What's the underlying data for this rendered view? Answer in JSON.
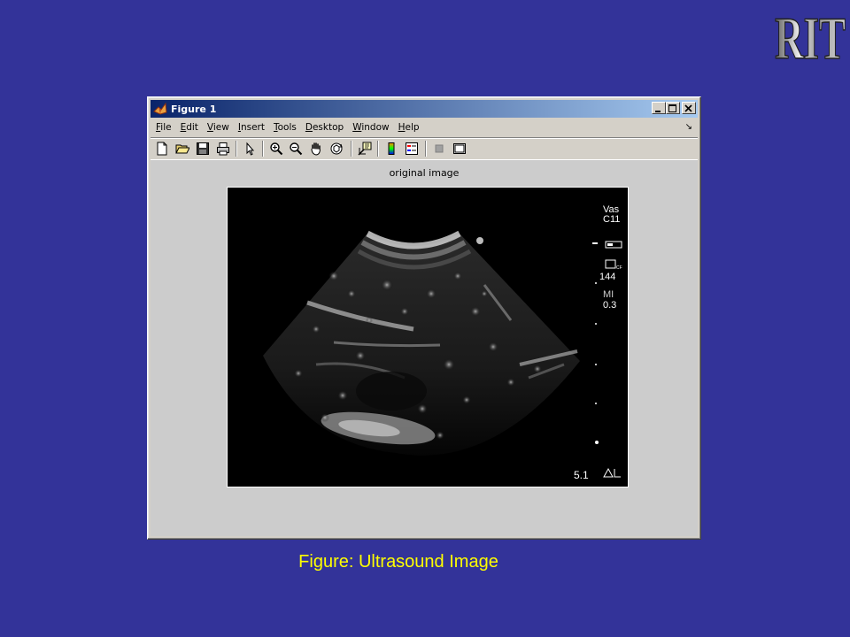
{
  "logo": {
    "text": "RIT"
  },
  "window": {
    "title": "Figure 1",
    "menu": [
      {
        "label": "File",
        "mnemonic": "F",
        "rest": "ile"
      },
      {
        "label": "Edit",
        "mnemonic": "E",
        "rest": "dit"
      },
      {
        "label": "View",
        "mnemonic": "V",
        "rest": "iew"
      },
      {
        "label": "Insert",
        "mnemonic": "I",
        "rest": "nsert"
      },
      {
        "label": "Tools",
        "mnemonic": "T",
        "rest": "ools"
      },
      {
        "label": "Desktop",
        "mnemonic": "D",
        "rest": "esktop"
      },
      {
        "label": "Window",
        "mnemonic": "W",
        "rest": "indow"
      },
      {
        "label": "Help",
        "mnemonic": "H",
        "rest": "elp"
      }
    ],
    "toolbar_icons": [
      "new-file-icon",
      "open-folder-icon",
      "save-icon",
      "print-icon",
      "pointer-icon",
      "zoom-in-icon",
      "zoom-out-icon",
      "pan-hand-icon",
      "rotate-3d-icon",
      "data-cursor-icon",
      "colorbar-icon",
      "legend-icon",
      "hide-plot-tools-icon",
      "show-plot-tools-icon"
    ]
  },
  "figure": {
    "plot_title": "original image",
    "overlay": {
      "preset_line1": "Vas",
      "preset_line2": "C11",
      "frame_rate": "144",
      "mi_label": "MI",
      "mi_value": "0.3",
      "depth": "5.1"
    }
  },
  "caption": "Figure: Ultrasound Image"
}
